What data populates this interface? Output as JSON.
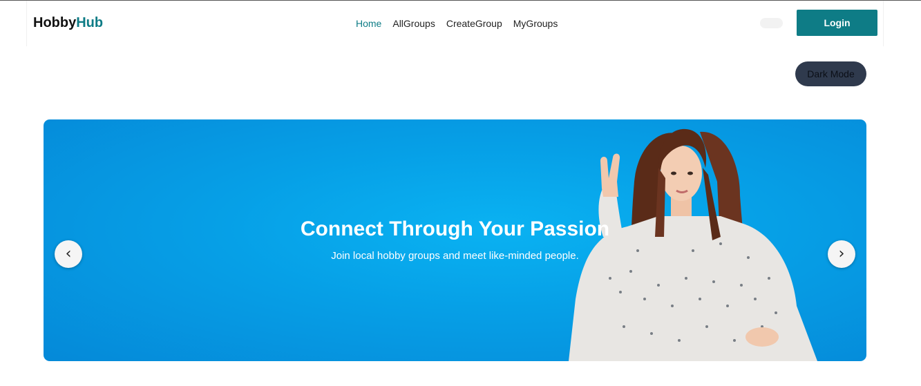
{
  "brand": {
    "name_part1": "Hobby",
    "name_part2": "Hub",
    "accent_color": "#0e7c86"
  },
  "nav": {
    "links": [
      {
        "label": "Home",
        "active": true
      },
      {
        "label": "AllGroups",
        "active": false
      },
      {
        "label": "CreateGroup",
        "active": false
      },
      {
        "label": "MyGroups",
        "active": false
      }
    ]
  },
  "header": {
    "login_label": "Login",
    "dark_mode_label": "Dark Mode"
  },
  "hero": {
    "title": "Connect Through Your Passion",
    "subtitle": "Join local hobby groups and meet like-minded people.",
    "prev_icon": "chevron-left-icon",
    "next_icon": "chevron-right-icon",
    "prev_glyph": "‹",
    "next_glyph": "›",
    "background_color": "#069fe6"
  }
}
